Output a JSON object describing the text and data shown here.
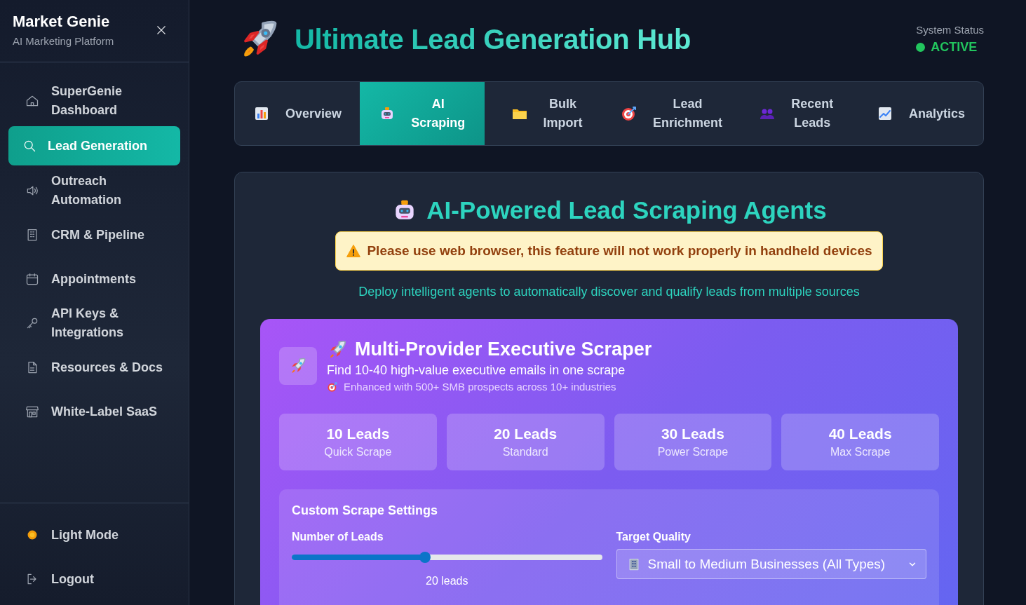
{
  "sidebar": {
    "brand": "Market Genie",
    "tagline": "AI Marketing Platform",
    "items": [
      {
        "label": "SuperGenie Dashboard",
        "selected": false
      },
      {
        "label": "Lead Generation",
        "selected": true
      },
      {
        "label": "Outreach Automation",
        "selected": false
      },
      {
        "label": "CRM & Pipeline",
        "selected": false
      },
      {
        "label": "Appointments",
        "selected": false
      },
      {
        "label": "API Keys & Integrations",
        "selected": false
      },
      {
        "label": "Resources & Docs",
        "selected": false
      },
      {
        "label": "White-Label SaaS",
        "selected": false
      }
    ],
    "footer_items": [
      {
        "label": "Light Mode"
      },
      {
        "label": "Logout"
      }
    ]
  },
  "header": {
    "title": "Ultimate Lead Generation Hub",
    "status_label": "System Status",
    "status": "ACTIVE"
  },
  "tabs": [
    {
      "label": "Overview",
      "selected": false
    },
    {
      "label": "AI Scraping",
      "selected": true
    },
    {
      "label": "Bulk Import",
      "selected": false
    },
    {
      "label": "Lead Enrichment",
      "selected": false
    },
    {
      "label": "Recent Leads",
      "selected": false
    },
    {
      "label": "Analytics",
      "selected": false
    }
  ],
  "panel": {
    "title": "AI-Powered Lead Scraping Agents",
    "warning": "Please use web browser, this feature will not work properly in handheld devices",
    "subtitle": "Deploy intelligent agents to automatically discover and qualify leads from multiple sources",
    "scraper": {
      "title": "Multi-Provider Executive Scraper",
      "description": "Find 10-40 high-value executive emails in one scrape",
      "note": "Enhanced with 500+ SMB prospects across 10+ industries",
      "presets": [
        {
          "count": "10 Leads",
          "name": "Quick Scrape"
        },
        {
          "count": "20 Leads",
          "name": "Standard"
        },
        {
          "count": "30 Leads",
          "name": "Power Scrape"
        },
        {
          "count": "40 Leads",
          "name": "Max Scrape"
        }
      ],
      "settings": {
        "title": "Custom Scrape Settings",
        "leads_label": "Number of Leads",
        "level": 0.43,
        "leads_reading": "20 leads",
        "quality_label": "Target Quality",
        "quality_value": "Small to Medium Businesses (All Types)"
      }
    }
  }
}
